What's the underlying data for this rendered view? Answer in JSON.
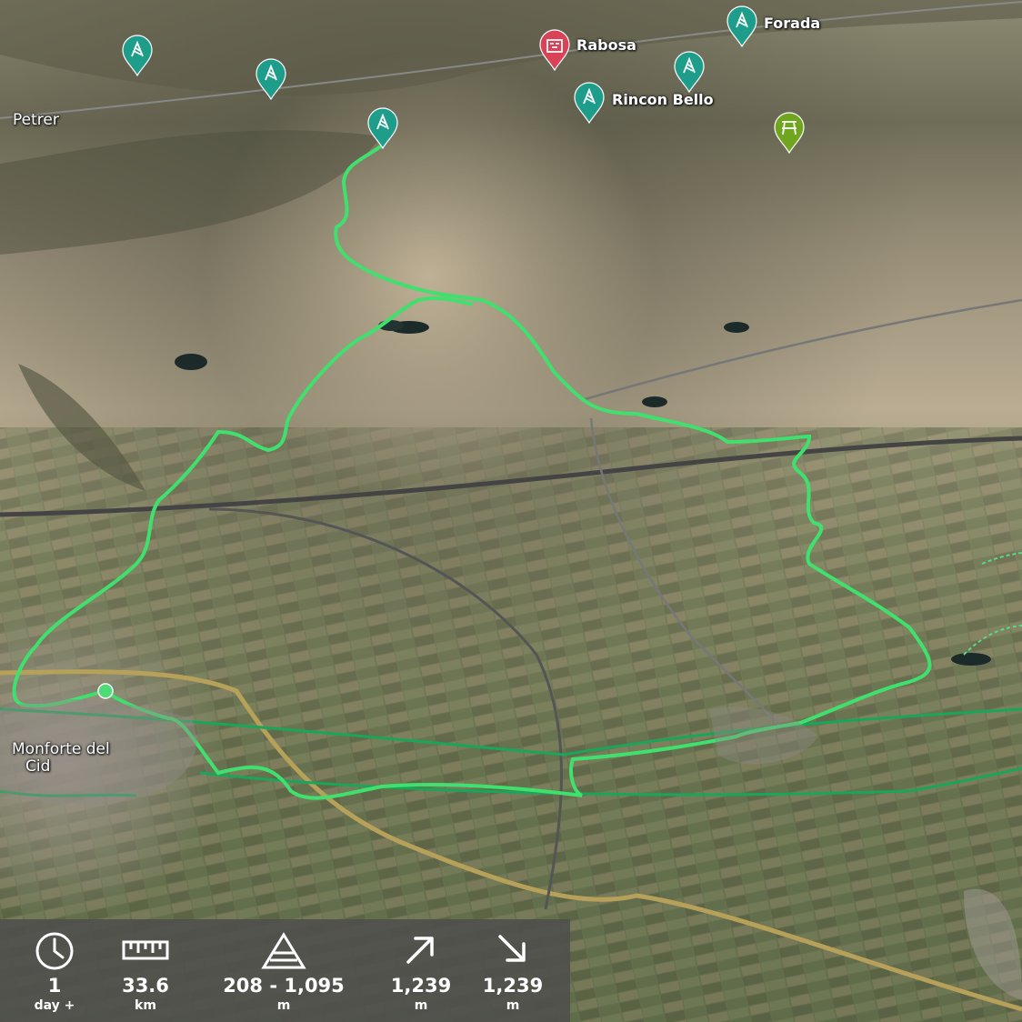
{
  "map": {
    "places": {
      "petrer": "Petrer",
      "monforte_line1": "Monforte del",
      "monforte_line2": "Cid"
    },
    "pois": {
      "rabosa": "Rabosa",
      "forada": "Forada",
      "rincon_bello": "Rincon Bello"
    },
    "colors": {
      "route": "#3fe06e",
      "trail": "#1aa65a",
      "poi_marker": "#1e9e8a",
      "poi_alert_marker": "#d94257",
      "picnic_marker": "#6fa51f",
      "road": "#b7a15a"
    }
  },
  "stats": {
    "duration": {
      "icon": "clock-icon",
      "value": "1",
      "unit": "day +"
    },
    "distance": {
      "icon": "ruler-icon",
      "value": "33.6",
      "unit": "km"
    },
    "elevation_range": {
      "icon": "mountain-icon",
      "value": "208 - 1,095",
      "unit": "m"
    },
    "ascent": {
      "icon": "arrow-up-right-icon",
      "value": "1,239",
      "unit": "m"
    },
    "descent": {
      "icon": "arrow-down-right-icon",
      "value": "1,239",
      "unit": "m"
    }
  }
}
